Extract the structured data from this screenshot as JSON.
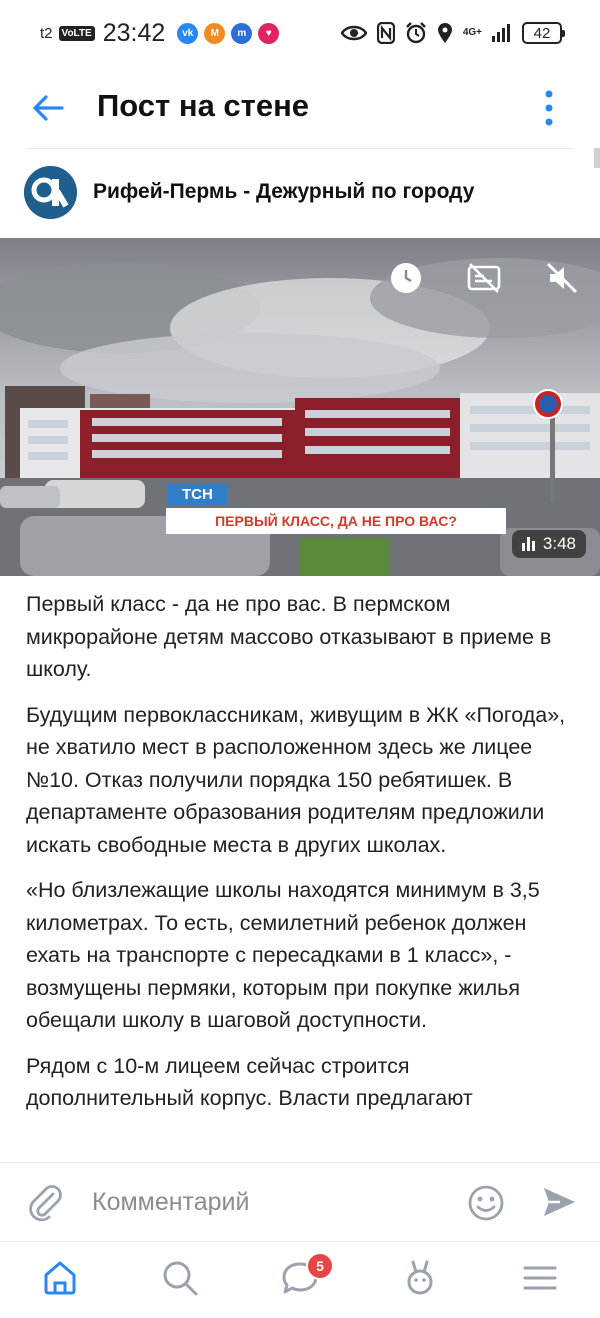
{
  "status_bar": {
    "carrier": "t2",
    "volte": "VoLTE",
    "time": "23:42",
    "network": "4G+",
    "battery": "42",
    "apps": [
      {
        "name": "vk-icon",
        "color": "#2787f5",
        "label": "vk"
      },
      {
        "name": "mail-icon",
        "color": "#f08a24",
        "label": "M"
      },
      {
        "name": "chat-app-icon",
        "color": "#2a6fd6",
        "label": "m"
      },
      {
        "name": "heart-app-icon",
        "color": "#e0245e",
        "label": "♥"
      }
    ]
  },
  "header": {
    "title": "Пост на стене"
  },
  "group": {
    "name": "Рифей-Пермь - Дежурный по городу"
  },
  "video": {
    "channel_badge": "TCH",
    "headline": "ПЕРВЫЙ КЛАСС, ДА НЕ ПРО ВАС?",
    "duration": "3:48"
  },
  "post": {
    "paragraphs": [
      "Первый класс - да не про вас. В пермском микрорайоне детям массово отказывают в приеме в школу.",
      "Будущим первоклассникам, живущим в ЖК «Погода», не хватило мест в расположенном здесь же лицее №10. Отказ получили порядка 150 ребятишек. В департаменте образования родителям предложили искать свободные места в других школах.",
      "«Но близлежащие школы находятся минимум в 3,5 километрах. То есть, семилетний ребенок должен ехать на транспорте с пересадками в 1 класс», - возмущены пермяки, которым при покупке жилья обещали школу в шаговой доступности.",
      "Рядом с 10-м лицеем сейчас строится дополнительный корпус. Власти предлагают"
    ]
  },
  "comment": {
    "placeholder": "Комментарий"
  },
  "nav": {
    "messages_badge": "5"
  },
  "colors": {
    "accent": "#2787f5",
    "icon_gray": "#99a2ad",
    "badge": "#e64646"
  }
}
